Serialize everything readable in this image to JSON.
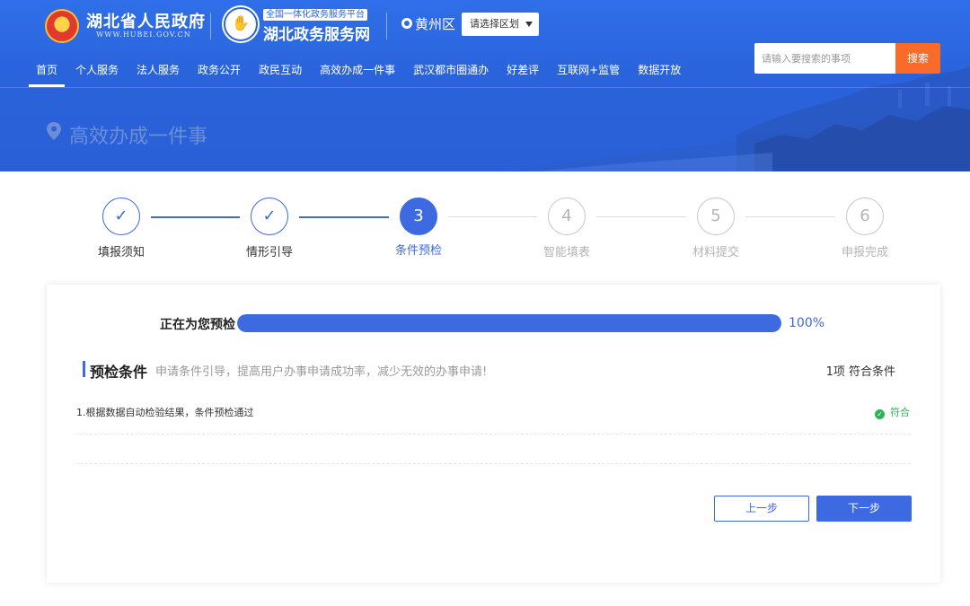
{
  "header": {
    "gov_title": "湖北省人民政府",
    "gov_url": "WWW.HUBEI.GOV.CN",
    "platform_tag": "全国一体化政务服务平台",
    "service_title": "湖北政务服务网",
    "region": "黄州区",
    "region_select": "请选择区划",
    "search_placeholder": "请输入要搜索的事项",
    "search_button": "搜索"
  },
  "nav": {
    "items": [
      {
        "label": "首页",
        "active": true
      },
      {
        "label": "个人服务"
      },
      {
        "label": "法人服务"
      },
      {
        "label": "政务公开"
      },
      {
        "label": "政民互动"
      },
      {
        "label": "高效办成一件事"
      },
      {
        "label": "武汉都市圈通办"
      },
      {
        "label": "好差评"
      },
      {
        "label": "互联网+监管"
      },
      {
        "label": "数据开放"
      }
    ]
  },
  "page": {
    "title": "高效办成一件事"
  },
  "steps": [
    {
      "number": "✓",
      "label": "填报须知",
      "state": "done"
    },
    {
      "number": "✓",
      "label": "情形引导",
      "state": "done"
    },
    {
      "number": "3",
      "label": "条件预检",
      "state": "current"
    },
    {
      "number": "4",
      "label": "智能填表",
      "state": "todo"
    },
    {
      "number": "5",
      "label": "材料提交",
      "state": "todo"
    },
    {
      "number": "6",
      "label": "申报完成",
      "state": "todo"
    }
  ],
  "precheck": {
    "label": "正在为您预检",
    "progress": 100,
    "progress_text": "100%"
  },
  "section": {
    "title": "预检条件",
    "subtitle": "申请条件引导，提高用户办事申请成功率，减少无效的办事申请!",
    "count": "1项 符合条件"
  },
  "conditions": [
    {
      "text": "1.根据数据自动检验结果，条件预检通过",
      "status": "符合"
    }
  ],
  "buttons": {
    "prev": "上一步",
    "next": "下一步"
  },
  "colors": {
    "primary": "#3d6ae0",
    "banner": "#2a63dc",
    "search_button": "#fa6a28",
    "success": "#2db35a"
  }
}
